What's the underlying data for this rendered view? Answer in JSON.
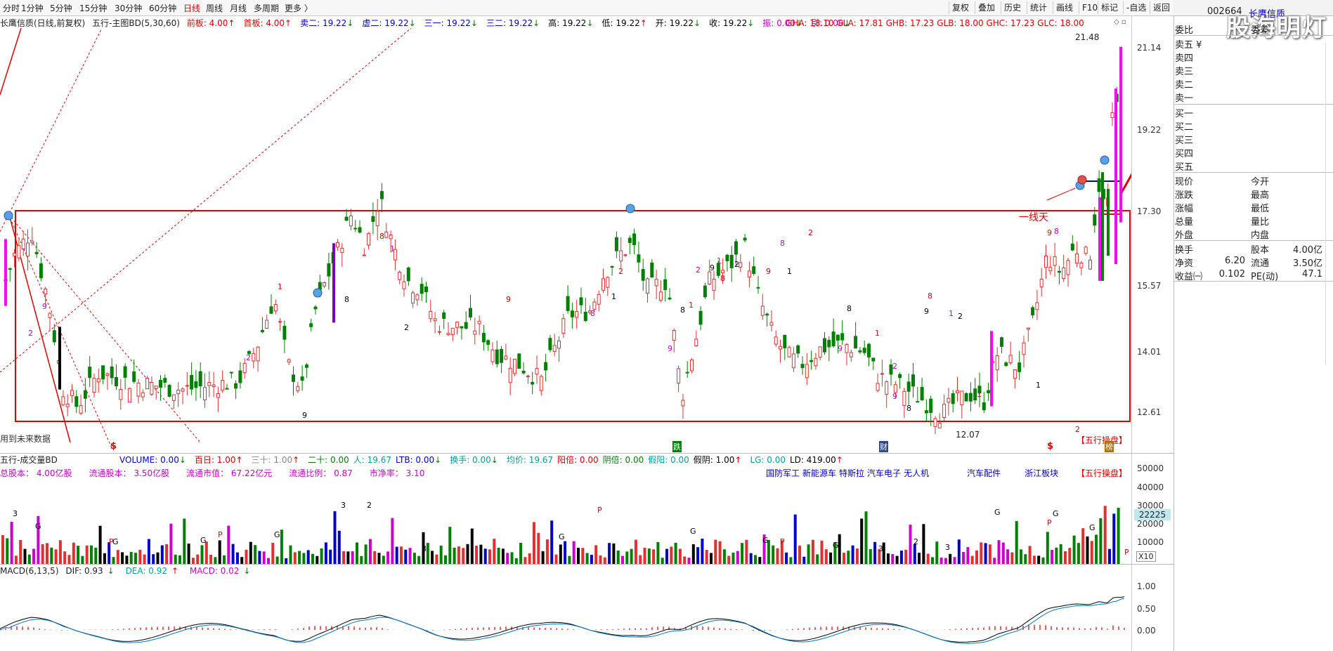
{
  "toolbar": {
    "periods": [
      "分时",
      "1分钟",
      "5分钟",
      "15分钟",
      "30分钟",
      "60分钟",
      "日线",
      "周线",
      "月线",
      "多周期",
      "更多 〉"
    ],
    "active_period": "日线",
    "right_buttons": [
      "复权",
      "叠加",
      "历史",
      "统计",
      "画线",
      "F10",
      "标记",
      "-自选",
      "返回"
    ]
  },
  "stock": {
    "name_line": "长鹰信质(日线,前复权)",
    "indicator_name": "五行-主图BD(5,30,60)",
    "quote_fields": [
      {
        "label": "前板:",
        "value": "4.00",
        "arrow": "↑",
        "color": "#e00000"
      },
      {
        "label": "首板:",
        "value": "4.00",
        "arrow": "↑",
        "color": "#e00000"
      },
      {
        "label": "卖二:",
        "value": "19.22",
        "arrow": "↓",
        "color": "#0000cc"
      },
      {
        "label": "虚二:",
        "value": "19.22",
        "arrow": "↓",
        "color": "#0000cc"
      },
      {
        "label": "三一:",
        "value": "19.22",
        "arrow": "↓",
        "color": "#0000cc"
      },
      {
        "label": "三二:",
        "value": "19.22",
        "arrow": "↓",
        "color": "#0000cc"
      },
      {
        "label": "高:",
        "value": "19.22",
        "arrow": "↓",
        "color": "#000000"
      },
      {
        "label": "低:",
        "value": "19.22",
        "arrow": "↑",
        "color": "#000000"
      },
      {
        "label": "开:",
        "value": "19.22",
        "arrow": "↓",
        "color": "#000000"
      },
      {
        "label": "收:",
        "value": "19.22",
        "arrow": "↓",
        "color": "#000000"
      },
      {
        "label": "振:",
        "value": "0.00",
        "arrow": "↓",
        "color": "#cc00cc"
      },
      {
        "label": "引:",
        "value": "0.00",
        "arrow": "↓",
        "color": "#cc00cc"
      }
    ],
    "gh_fields": "GHA: 18.10  GLA: 17.81  GHB: 17.23  GLB: 18.00  GHC: 17.23  GLC: 18.00"
  },
  "main_chart": {
    "price_axis": [
      "21.14",
      "19.22",
      "17.30",
      "15.57",
      "14.01",
      "12.61"
    ],
    "high_label": "21.48",
    "low_label": "12.07",
    "annotation_line_label": "一线天",
    "bottom_left_note": "用到未来数据",
    "bottom_right_badge": "【五行操盘】",
    "event_markers": [
      "$",
      "跌",
      "财",
      "$",
      "榜"
    ],
    "marker_numbers": [
      "9",
      "8",
      "1",
      "2",
      "9",
      "8",
      "1",
      "2",
      "9",
      "8",
      "1",
      "2",
      "9",
      "8",
      "1",
      "2",
      "9",
      "8",
      "1",
      "2",
      "9",
      "8",
      "1",
      "2",
      "9",
      "8",
      "1",
      "2",
      "9",
      "8",
      "1",
      "2",
      "9",
      "8",
      "1",
      "2",
      "9",
      "8",
      "1",
      "2"
    ]
  },
  "volume": {
    "title": "五行-成交量BD",
    "fields": [
      {
        "label": "VOLUME:",
        "value": "0.00",
        "arrow": "↓",
        "color": "#0000cc"
      },
      {
        "label": "百日:",
        "value": "1.00",
        "arrow": "↑",
        "color": "#e00000"
      },
      {
        "label": "三十:",
        "value": "1.00",
        "arrow": "↑",
        "color": "#888888"
      },
      {
        "label": "二十:",
        "value": "0.00",
        "arrow": "",
        "color": "#008000"
      },
      {
        "label": "人:",
        "value": "19.67",
        "arrow": "",
        "color": "#00a0a0"
      },
      {
        "label": "LTB:",
        "value": "0.00",
        "arrow": "↓",
        "color": "#0000cc"
      },
      {
        "label": "换手:",
        "value": "0.00",
        "arrow": "↓",
        "color": "#00a0a0"
      },
      {
        "label": "均价:",
        "value": "19.67",
        "arrow": "",
        "color": "#00a0a0"
      },
      {
        "label": "阳倍:",
        "value": "0.00",
        "arrow": "",
        "color": "#e00000"
      },
      {
        "label": "阴倍:",
        "value": "0.00",
        "arrow": "",
        "color": "#008000"
      },
      {
        "label": "假阳:",
        "value": "0.00",
        "arrow": "",
        "color": "#00a0a0"
      },
      {
        "label": "假阴:",
        "value": "1.00",
        "arrow": "↑",
        "color": "#000000"
      },
      {
        "label": "LG:",
        "value": "0.00",
        "arrow": "",
        "color": "#00a0a0"
      },
      {
        "label": "LD:",
        "value": "419.00",
        "arrow": "↑",
        "color": "#000000"
      }
    ],
    "stats": [
      {
        "label": "总股本：",
        "value": "4.00亿股"
      },
      {
        "label": "流通股本：",
        "value": "3.50亿股"
      },
      {
        "label": "流通市值：",
        "value": "67.22亿元"
      },
      {
        "label": "流通比例：",
        "value": "0.87"
      },
      {
        "label": "市净率：",
        "value": "3.10"
      }
    ],
    "concepts": [
      "国防军工",
      "新能源车",
      "特斯拉",
      "汽车电子",
      "无人机"
    ],
    "concepts2": [
      "汽车配件",
      "浙江板块"
    ],
    "badge": "【五行操盘】",
    "axis": [
      "50000",
      "40000",
      "30000",
      "20000",
      "10000"
    ],
    "current_value": "22225",
    "scale": "X10",
    "volume_markers": [
      "3",
      "G",
      "P",
      "G",
      "G",
      "P",
      "G",
      "3",
      "2"
    ]
  },
  "macd": {
    "title": "MACD(6,13,5)",
    "dif": "0.93",
    "dea": "0.92",
    "macd": "0.02",
    "axis": [
      "1.00",
      "0.50",
      "0.00"
    ]
  },
  "quote_panel": {
    "code": "002664",
    "name": "长鹰信质",
    "watermark": "股海明灯",
    "weibi_label": "委比",
    "weicha_label": "委差",
    "sell": [
      "卖五 ¥",
      "卖四",
      "卖三",
      "卖二",
      "卖一"
    ],
    "buy": [
      "买一",
      "买二",
      "买三",
      "买四",
      "买五"
    ],
    "stats_left": [
      "现价",
      "涨跌",
      "涨幅",
      "总量",
      "外盘"
    ],
    "stats_right": [
      "今开",
      "最高",
      "最低",
      "量比",
      "内盘"
    ],
    "fund": [
      {
        "l1": "换手",
        "v1": "",
        "l2": "股本",
        "v2": "4.00亿"
      },
      {
        "l1": "净资",
        "v1": "6.20",
        "l2": "流通",
        "v2": "3.50亿"
      },
      {
        "l1": "收益㈠",
        "v1": "0.102",
        "l2": "PE(动)",
        "v2": "47.1"
      }
    ]
  }
}
